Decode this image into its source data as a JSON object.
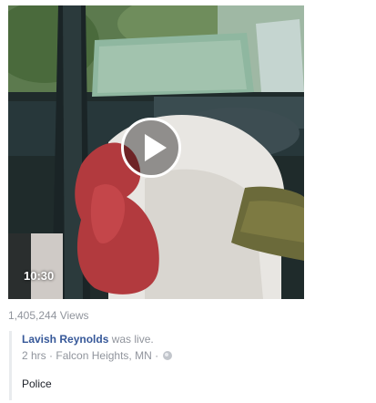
{
  "video": {
    "duration": "10:30",
    "play_icon": "play-icon"
  },
  "views_text": "1,405,244 Views",
  "shared_post": {
    "author": "Lavish Reynolds",
    "action": "was live.",
    "time": "2 hrs",
    "separator": "·",
    "location": "Falcon Heights, MN",
    "privacy_icon": "globe-icon",
    "text": "Police"
  },
  "colors": {
    "link": "#365899",
    "meta": "#90949c",
    "text": "#1d2129",
    "border": "#e9ebee"
  }
}
